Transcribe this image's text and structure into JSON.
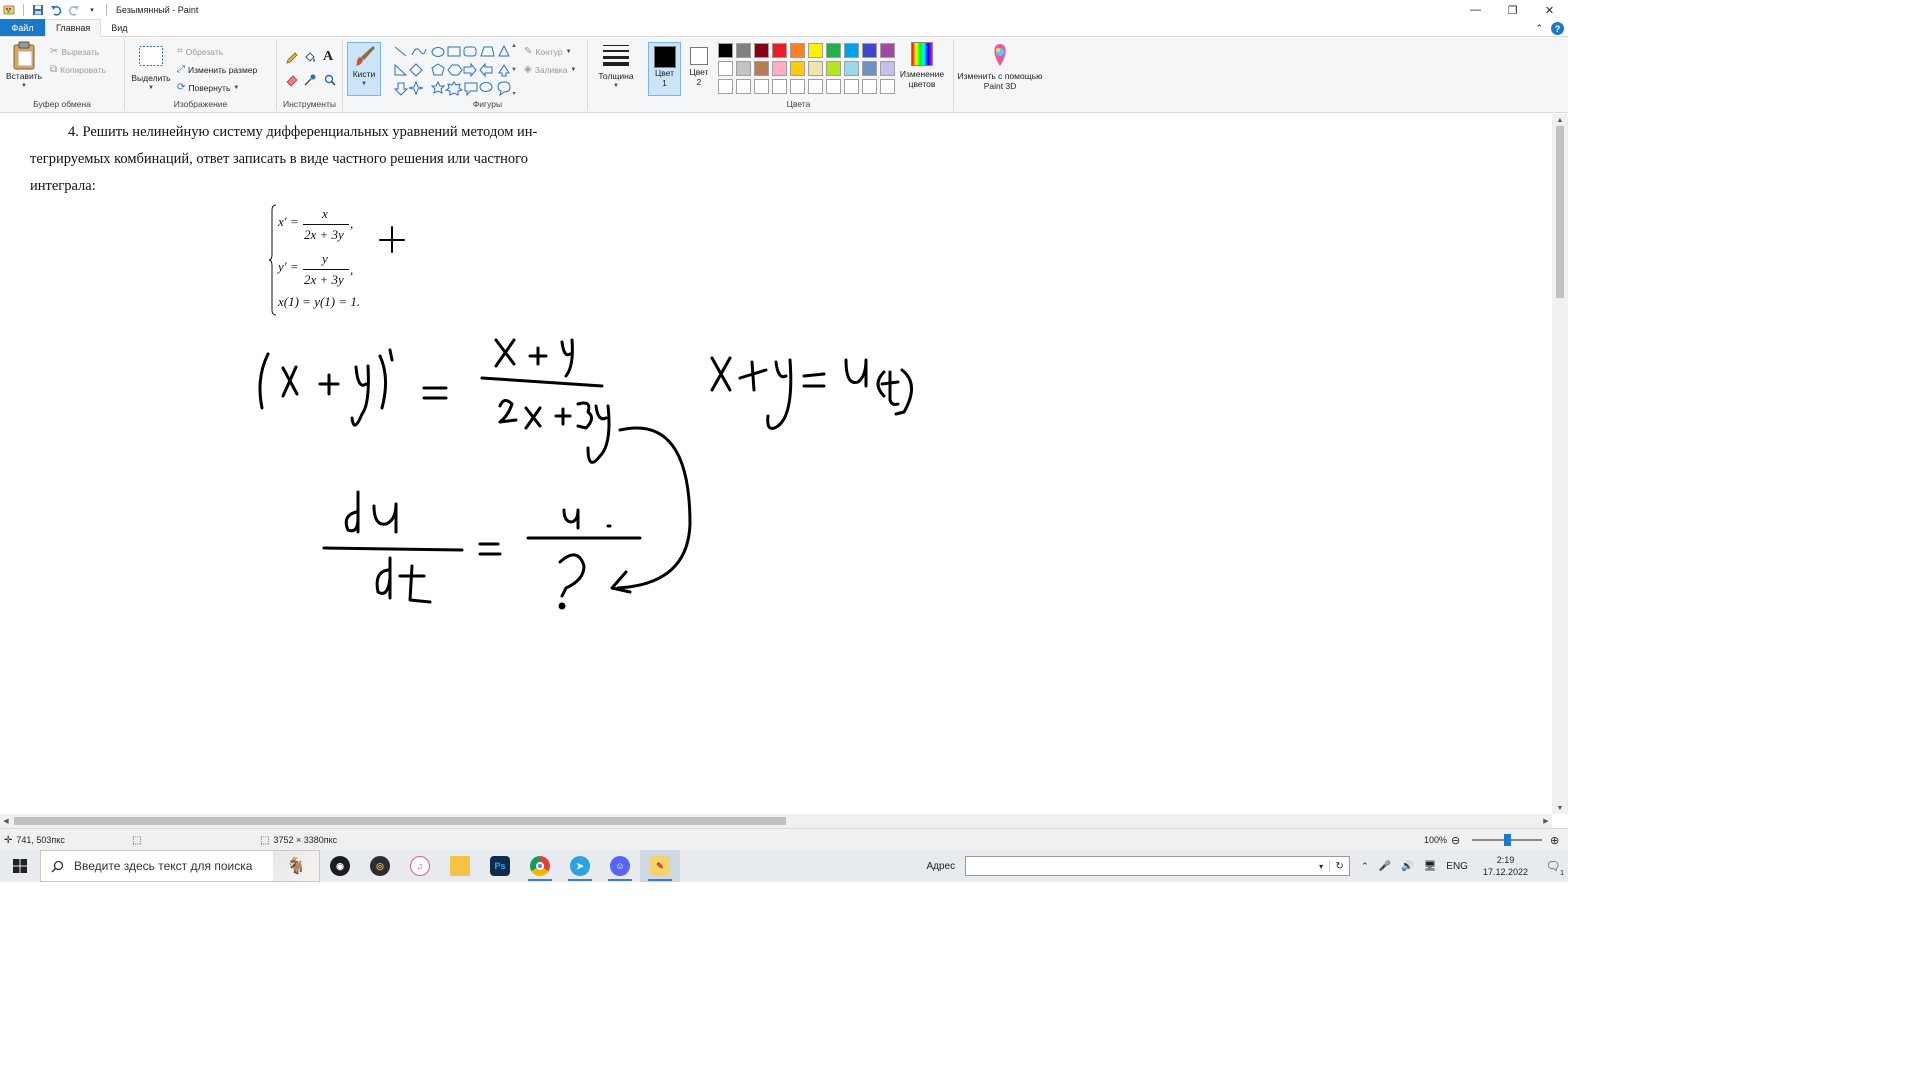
{
  "window": {
    "title": "Безымянный - Paint",
    "controls": {
      "minimize": "—",
      "maximize": "❐",
      "close": "✕"
    }
  },
  "tabs": [
    {
      "label": "Файл"
    },
    {
      "label": "Главная"
    },
    {
      "label": "Вид"
    }
  ],
  "ribbon": {
    "clipboard": {
      "paste": "Вставить",
      "cut": "Вырезать",
      "copy": "Копировать",
      "group": "Буфер обмена"
    },
    "image": {
      "select": "Выделить",
      "crop": "Обрезать",
      "resize": "Изменить размер",
      "rotate": "Повернуть",
      "group": "Изображение"
    },
    "tools": {
      "group": "Инструменты"
    },
    "brushes": {
      "label": "Кисти"
    },
    "shapes": {
      "outline": "Контур",
      "fill": "Заливка",
      "group": "Фигуры"
    },
    "size": {
      "label": "Толщина"
    },
    "colors": {
      "color1": "Цвет 1",
      "color2": "Цвет 2",
      "edit": "Изменение цветов",
      "group": "Цвета",
      "palette": [
        "#000000",
        "#7f7f7f",
        "#880015",
        "#ed1c24",
        "#ff7f27",
        "#fff200",
        "#22b14c",
        "#00a2e8",
        "#3f48cc",
        "#a349a4",
        "#ffffff",
        "#c3c3c3",
        "#b97a57",
        "#ffaec9",
        "#ffc90e",
        "#efe4b0",
        "#b5e61d",
        "#99d9ea",
        "#7092be",
        "#c8bfe7",
        "#ffffff",
        "#ffffff",
        "#ffffff",
        "#ffffff",
        "#ffffff",
        "#ffffff",
        "#ffffff",
        "#ffffff",
        "#ffffff",
        "#ffffff"
      ]
    },
    "paint3d": {
      "label": "Изменить с помощью Paint 3D"
    }
  },
  "document": {
    "line1": "4. Решить нелинейную систему дифференциальных уравнений  методом ин-",
    "line2": "тегрируемых комбинаций, ответ записать в виде частного решения или частного",
    "line3": "интеграла:",
    "eq1_lhs": "x′ =",
    "eq1_num": "x",
    "eq1_den": "2x + 3y",
    "eq2_lhs": "y′ =",
    "eq2_num": "y",
    "eq2_den": "2x + 3y",
    "eq3": "x(1) = y(1) = 1."
  },
  "status": {
    "cursor_pos": "741, 503пкс",
    "canvas_size": "3752 × 3380пкс",
    "zoom": "100%"
  },
  "taskbar": {
    "search_placeholder": "Введите здесь текст для поиска",
    "address_label": "Адрес",
    "lang": "ENG",
    "time": "2:19",
    "date": "17.12.2022",
    "notifications": "1"
  }
}
